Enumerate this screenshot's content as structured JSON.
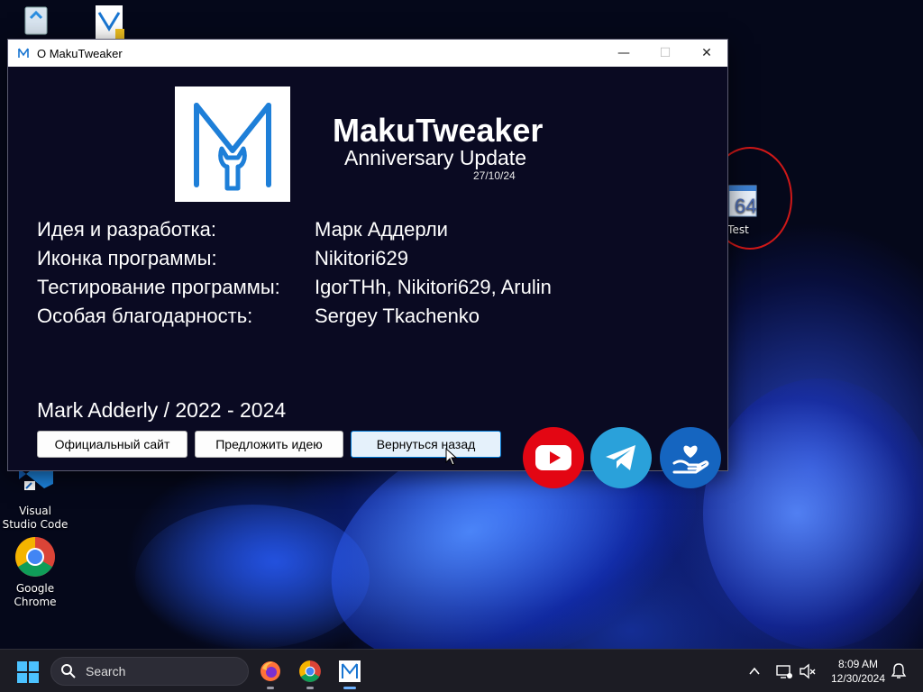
{
  "desktop": {
    "icons": [
      {
        "label": ""
      },
      {
        "label": ""
      },
      {
        "label": "Test"
      },
      {
        "label": "Visual Studio Code"
      },
      {
        "label": "Google Chrome"
      }
    ]
  },
  "window": {
    "title": "О MakuTweaker",
    "controls": {
      "minimize": "—",
      "maximize": "☐",
      "close": "✕"
    }
  },
  "about": {
    "app_name": "MakuTweaker",
    "edition": "Anniversary Update",
    "date": "27/10/24",
    "credits": [
      {
        "label": "Идея и разработка:",
        "value": "Марк Аддерли"
      },
      {
        "label": "Иконка программы:",
        "value": "Nikitori629"
      },
      {
        "label": "Тестирование программы:",
        "value": "IgorTHh, Nikitori629, Arulin"
      },
      {
        "label": "Особая благодарность:",
        "value": "Sergey Tkachenko"
      }
    ],
    "copyright": "Mark Adderly / 2022 - 2024",
    "buttons": {
      "official_site": "Официальный сайт",
      "suggest_idea": "Предложить идею",
      "go_back": "Вернуться назад"
    },
    "social": [
      "youtube-icon",
      "telegram-icon",
      "donate-icon"
    ],
    "colors": {
      "youtube": "#e30613",
      "telegram": "#2aa1da",
      "donate": "#1565c0"
    }
  },
  "taskbar": {
    "search_placeholder": "Search",
    "apps": [
      "firefox-icon",
      "chrome-icon",
      "makutweaker-icon"
    ],
    "time": "8:09 AM",
    "date": "12/30/2024"
  }
}
